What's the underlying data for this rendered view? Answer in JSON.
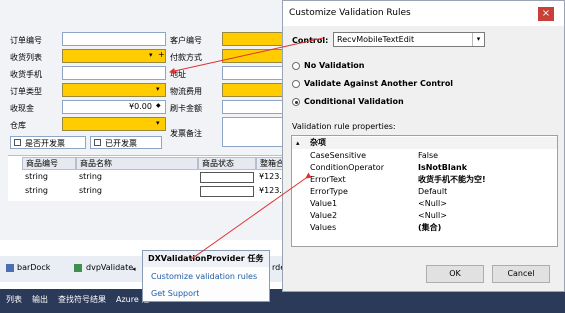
{
  "form": {
    "labels": {
      "order_no": "订单编号",
      "receive_list": "收货列表",
      "receive_phone": "收货手机",
      "order_type": "订单类型",
      "receive_amount": "收现金",
      "warehouse": "仓库",
      "customer_no": "客户编号",
      "pay_method": "付款方式",
      "address": "地址",
      "logistics_fee": "物流费用",
      "card_amount": "刷卡金额",
      "ship_remark": "发票备注"
    },
    "amount_value": "¥0.00",
    "invoice_checks": [
      "是否开发票",
      "已开发票"
    ],
    "grid": {
      "headers": [
        "商品编号",
        "商品名称",
        "商品状态",
        "整箱合"
      ],
      "rows": [
        [
          "string",
          "string",
          "",
          "¥123.0"
        ],
        [
          "string",
          "string",
          "",
          "¥123.0"
        ]
      ]
    }
  },
  "dialog": {
    "title": "Customize Validation Rules",
    "control_label": "Control:",
    "control_value": "RecvMobileTextEdit",
    "options": [
      "No Validation",
      "Validate Against Another Control",
      "Conditional Validation"
    ],
    "selected_option": 2,
    "props_title": "Validation rule properties:",
    "category": "杂项",
    "properties": [
      {
        "name": "CaseSensitive",
        "value": "False",
        "bold": false
      },
      {
        "name": "ConditionOperator",
        "value": "IsNotBlank",
        "bold": true
      },
      {
        "name": "ErrorText",
        "value": "收货手机不能为空!",
        "bold": true
      },
      {
        "name": "ErrorType",
        "value": "Default",
        "bold": false
      },
      {
        "name": "Value1",
        "value": "<Null>",
        "bold": false
      },
      {
        "name": "Value2",
        "value": "<Null>",
        "bold": false
      },
      {
        "name": "Values",
        "value": "(集合)",
        "bold": true
      }
    ],
    "ok": "OK",
    "cancel": "Cancel"
  },
  "bottom": {
    "tabs": [
      "barDock",
      "dvpValidate",
      "rde"
    ],
    "popup": {
      "title": "DXValidationProvider 任务",
      "links": [
        "Customize validation rules",
        "Get Support"
      ]
    },
    "status_items": [
      "列表",
      "输出",
      "查找符号结果",
      "Azure 活"
    ]
  },
  "colors": {
    "required": "#ffcc00",
    "arrow": "#e03030",
    "status_bar": "#2c3a5a",
    "link": "#1f5ea8"
  }
}
